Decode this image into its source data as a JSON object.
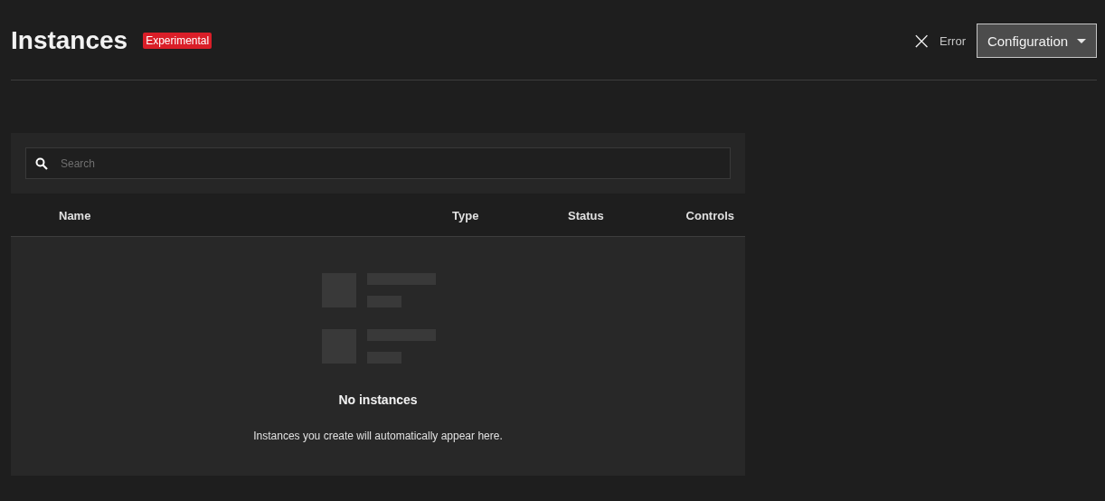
{
  "header": {
    "title": "Instances",
    "badge": "Experimental",
    "status": {
      "icon": "×",
      "label": "Error"
    },
    "menu_button": {
      "label": "Configuration"
    }
  },
  "search": {
    "placeholder": "Search"
  },
  "table": {
    "columns": [
      {
        "label": "Name"
      },
      {
        "label": "Type"
      },
      {
        "label": "Status"
      },
      {
        "label": "Controls"
      }
    ]
  },
  "empty_state": {
    "title": "No instances",
    "message": "Instances you create will automatically appear here."
  }
}
